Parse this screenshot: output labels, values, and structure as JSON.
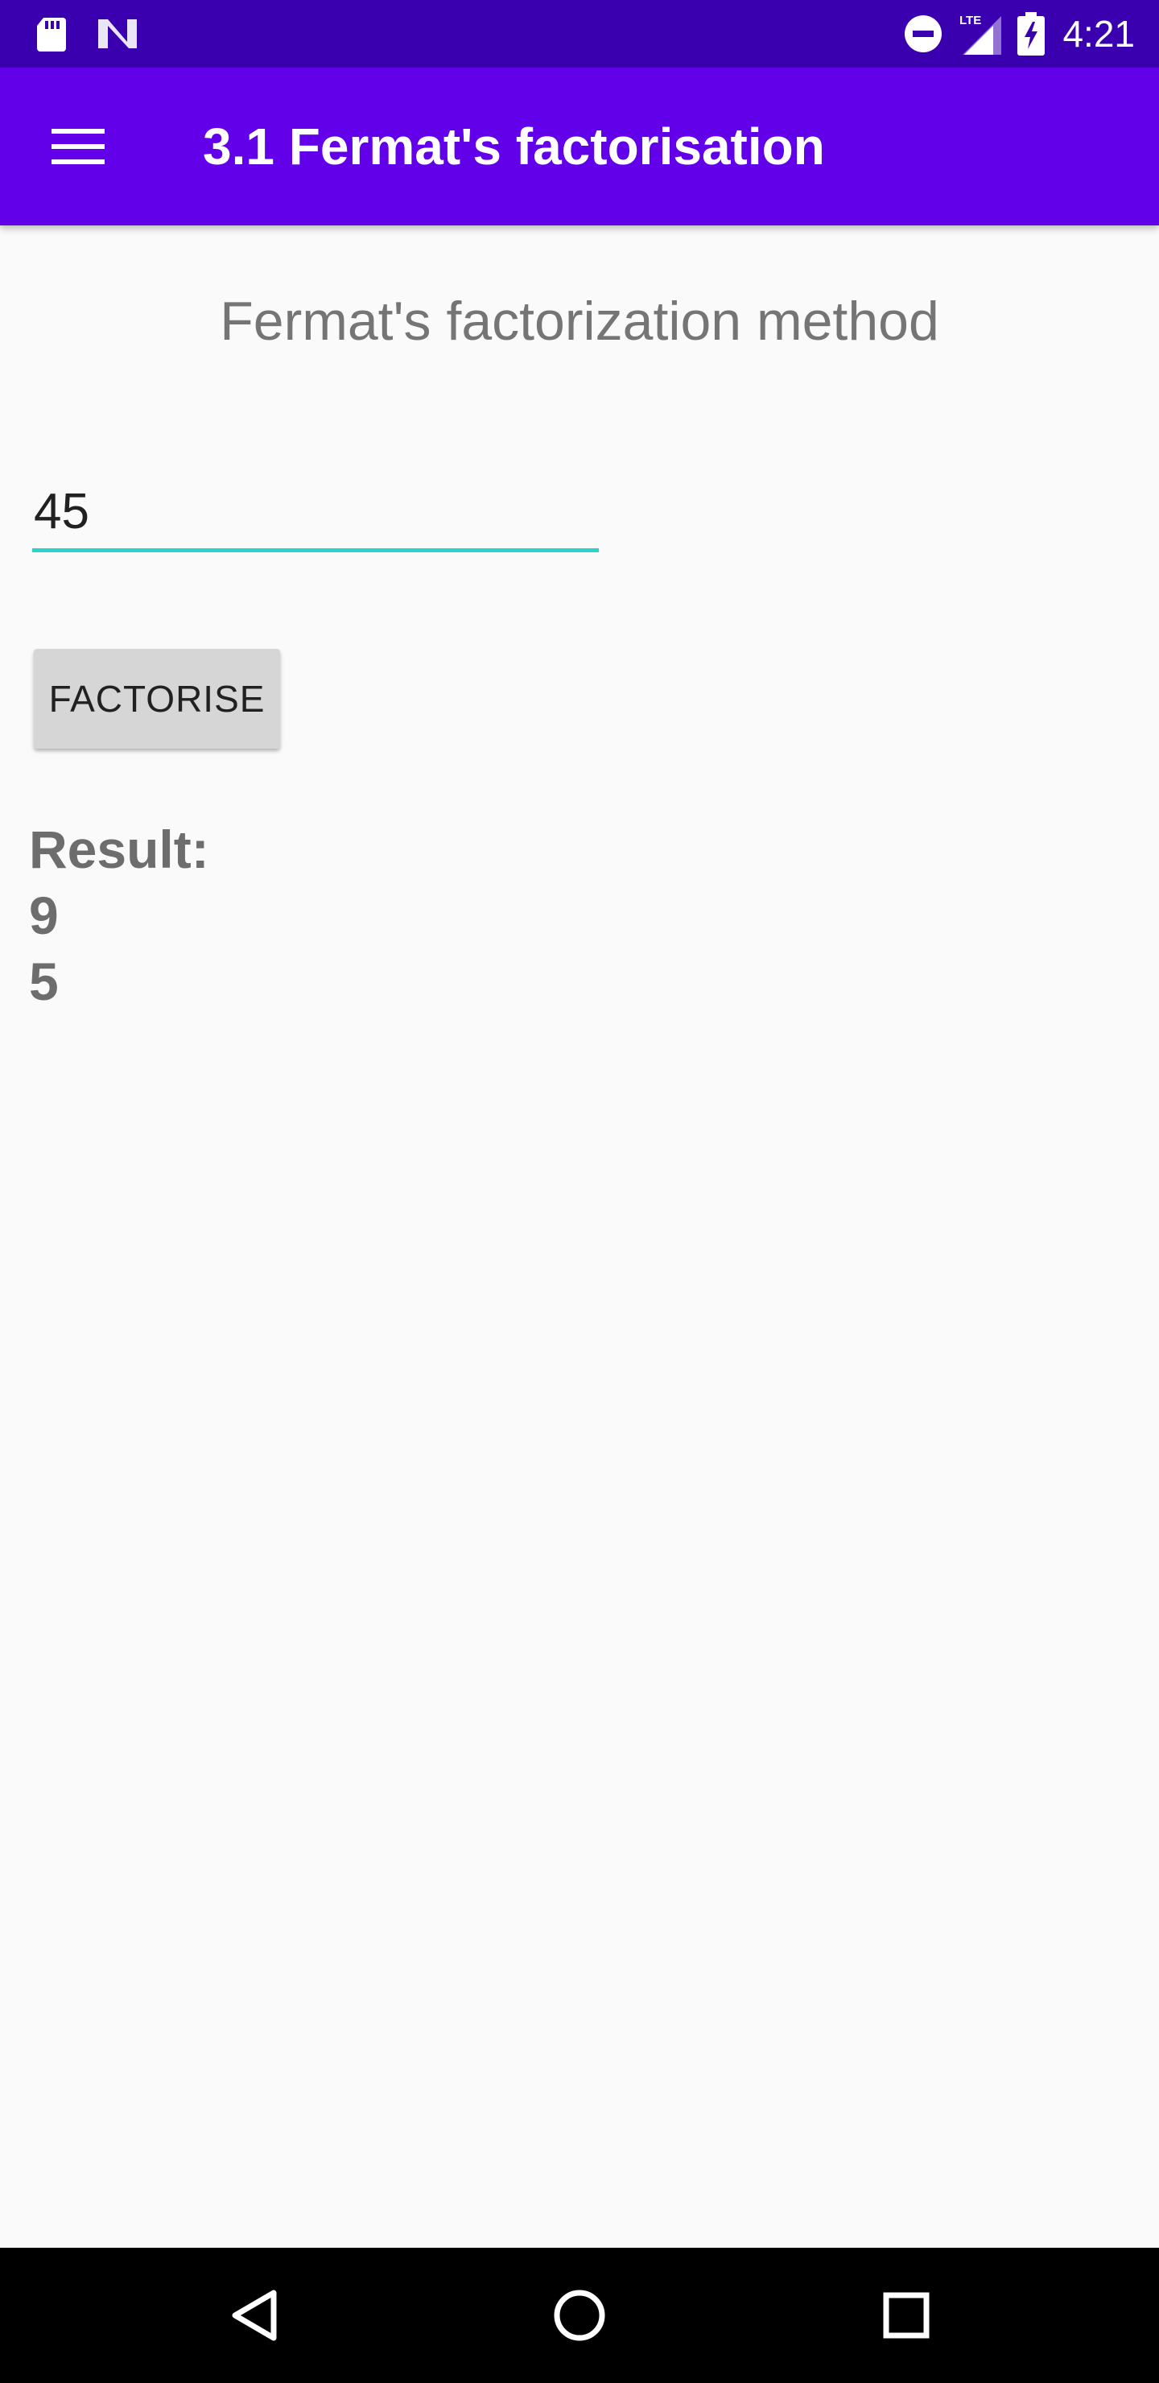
{
  "status_bar": {
    "time": "4:21",
    "network": "LTE",
    "icons": [
      "sd-card-icon",
      "n-logo-icon",
      "do-not-disturb-icon",
      "lte-signal-icon",
      "battery-charging-icon"
    ],
    "background": "#3a00b0"
  },
  "app_bar": {
    "title": "3.1 Fermat's factorisation",
    "background": "#6200ea",
    "menu_icon": "menu-icon"
  },
  "main": {
    "heading": "Fermat's factorization method",
    "input_value": "45",
    "input_underline_color": "#2ad4c8",
    "button_label": "FACTORISE",
    "result": {
      "label": "Result:",
      "values": [
        "9",
        "5"
      ]
    }
  },
  "nav_bar": {
    "icons": [
      "back-icon",
      "home-icon",
      "recent-apps-icon"
    ]
  }
}
